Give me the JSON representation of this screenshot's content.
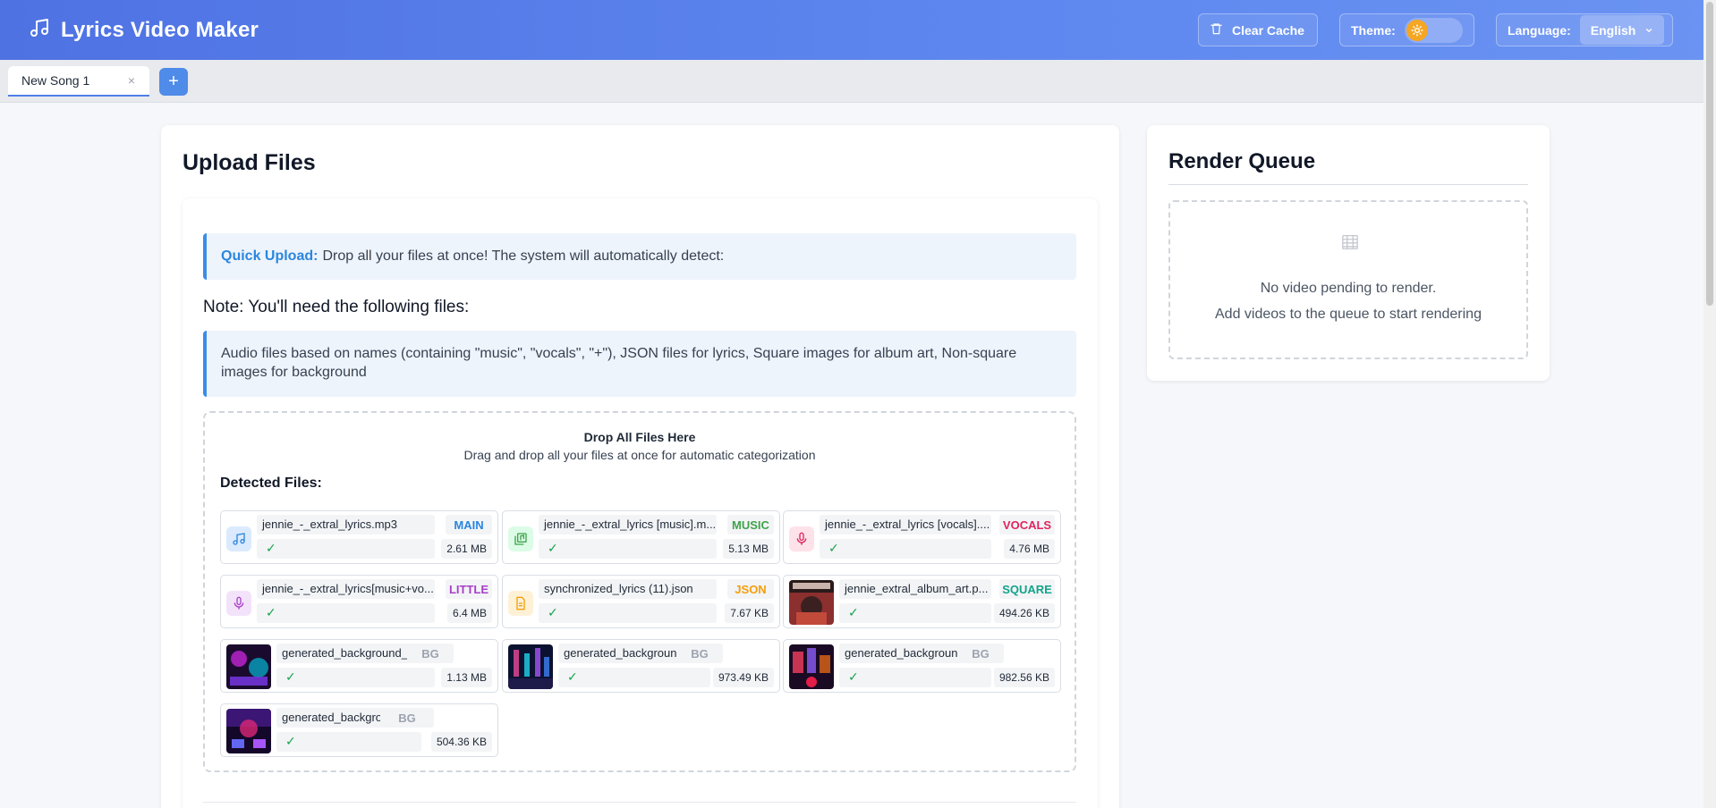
{
  "app": {
    "title": "Lyrics Video Maker",
    "icon": "music-note-icon"
  },
  "header": {
    "clear_cache": "Clear Cache",
    "theme_label": "Theme:",
    "language_label": "Language:",
    "language_value": "English"
  },
  "tabs": [
    {
      "label": "New Song 1",
      "close": "×"
    }
  ],
  "add_tab": "+",
  "upload": {
    "title": "Upload Files",
    "quick_label": "Quick Upload:",
    "quick_text": "Drop all your files at once! The system will automatically detect:",
    "note_title": "Note: You'll need the following files:",
    "note_text": "Audio files based on names (containing \"music\", \"vocals\", \"+\"), JSON files for lyrics, Square images for album art, Non-square images for background",
    "drop_title": "Drop All Files Here",
    "drop_sub": "Drag and drop all your files at once for automatic categorization",
    "detected_label": "Detected Files:",
    "files": [
      {
        "name": "jennie_-_extral_lyrics.mp3",
        "badge": "MAIN",
        "size": "2.61 MB",
        "check": "✓",
        "badge_color": "#2a86e0",
        "icon": "music-note-icon"
      },
      {
        "name": "jennie_-_extral_lyrics [music].m...",
        "badge": "MUSIC",
        "size": "5.13 MB",
        "check": "✓",
        "badge_color": "#3fa34d",
        "icon": "music-library-icon"
      },
      {
        "name": "jennie_-_extral_lyrics [vocals]....",
        "badge": "VOCALS",
        "size": "4.76 MB",
        "check": "✓",
        "badge_color": "#e0245e",
        "icon": "microphone-icon"
      },
      {
        "name": "jennie_-_extral_lyrics[music+vo...",
        "badge": "LITTLE",
        "size": "6.4 MB",
        "check": "✓",
        "badge_color": "#a83fc8",
        "icon": "microphone-icon"
      },
      {
        "name": "synchronized_lyrics (11).json",
        "badge": "JSON",
        "size": "7.67 KB",
        "check": "✓",
        "badge_color": "#f59e0b",
        "icon": "document-icon"
      },
      {
        "name": "jennie_extral_album_art.p...",
        "badge": "SQUARE",
        "size": "494.26 KB",
        "check": "✓",
        "badge_color": "#14a38b",
        "icon": "album-art-thumbnail"
      },
      {
        "name": "generated_background_jen...",
        "badge": "BG",
        "size": "1.13 MB",
        "check": "✓",
        "badge_color": "#9ca3af",
        "icon": "background-thumbnail"
      },
      {
        "name": "generated_background_j...",
        "badge": "BG",
        "size": "973.49 KB",
        "check": "✓",
        "badge_color": "#9ca3af",
        "icon": "background-thumbnail"
      },
      {
        "name": "generated_background_j...",
        "badge": "BG",
        "size": "982.56 KB",
        "check": "✓",
        "badge_color": "#9ca3af",
        "icon": "background-thumbnail"
      },
      {
        "name": "generated_background_j...",
        "badge": "BG",
        "size": "504.36 KB",
        "check": "✓",
        "badge_color": "#9ca3af",
        "icon": "background-thumbnail"
      }
    ]
  },
  "queue": {
    "title": "Render Queue",
    "empty_line1": "No video pending to render.",
    "empty_line2": "Add videos to the queue to start rendering",
    "icon": "film-icon"
  },
  "colors": {
    "header_start": "#4f72e3",
    "header_end": "#6a93f2",
    "accent": "#3b8de6"
  }
}
